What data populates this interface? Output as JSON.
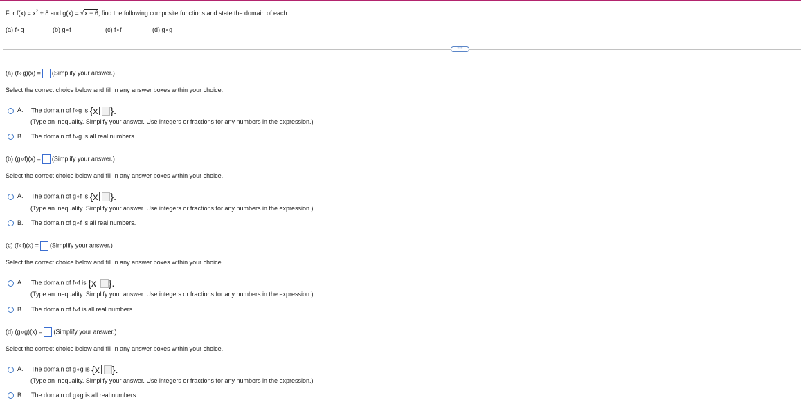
{
  "problem": {
    "prefix": "For f(x) = x",
    "exponent": "2",
    "mid": " + 8 and g(x) = ",
    "radical_sign": "√",
    "radicand": "x − 6",
    "suffix": ", find the following composite functions and state the domain of each.",
    "labels": [
      "(a)  f∘g",
      "(b)  g∘f",
      "(c)  f∘f",
      "(d)  g∘g"
    ]
  },
  "more_button": "•••",
  "parts": [
    {
      "expr_label": "(a) (f∘g)(x) =",
      "simplify_hint": "(Simplify your answer.)",
      "select_instruction": "Select the correct choice below and fill in any answer boxes within your choice.",
      "choice_a_letter": "A.",
      "choice_a_text": "The domain of f∘g is",
      "set_open": "{x",
      "set_close": "}.",
      "choice_a_hint": "(Type an inequality. Simplify your answer. Use integers or fractions for any numbers in the expression.)",
      "choice_b_letter": "B.",
      "choice_b_text": "The domain of f∘g is all real numbers."
    },
    {
      "expr_label": "(b) (g∘f)(x) =",
      "simplify_hint": "(Simplify your answer.)",
      "select_instruction": "Select the correct choice below and fill in any answer boxes within your choice.",
      "choice_a_letter": "A.",
      "choice_a_text": "The domain of g∘f is",
      "set_open": "{x",
      "set_close": "}.",
      "choice_a_hint": "(Type an inequality. Simplify your answer. Use integers or fractions for any numbers in the expression.)",
      "choice_b_letter": "B.",
      "choice_b_text": "The domain of g∘f is all real numbers."
    },
    {
      "expr_label": "(c) (f∘f)(x) =",
      "simplify_hint": "(Simplify your answer.)",
      "select_instruction": "Select the correct choice below and fill in any answer boxes within your choice.",
      "choice_a_letter": "A.",
      "choice_a_text": "The domain of f∘f is",
      "set_open": "{x",
      "set_close": "}.",
      "choice_a_hint": "(Type an inequality. Simplify your answer. Use integers or fractions for any numbers in the expression.)",
      "choice_b_letter": "B.",
      "choice_b_text": "The domain of f∘f is all real numbers."
    },
    {
      "expr_label": "(d) (g∘g)(x) =",
      "simplify_hint": "(Simplify your answer.)",
      "select_instruction": "Select the correct choice below and fill in any answer boxes within your choice.",
      "choice_a_letter": "A.",
      "choice_a_text": "The domain of g∘g is",
      "set_open": "{x",
      "set_close": "}.",
      "choice_a_hint": "(Type an inequality. Simplify your answer. Use integers or fractions for any numbers in the expression.)",
      "choice_b_letter": "B.",
      "choice_b_text": "The domain of g∘g is all real numbers."
    }
  ]
}
